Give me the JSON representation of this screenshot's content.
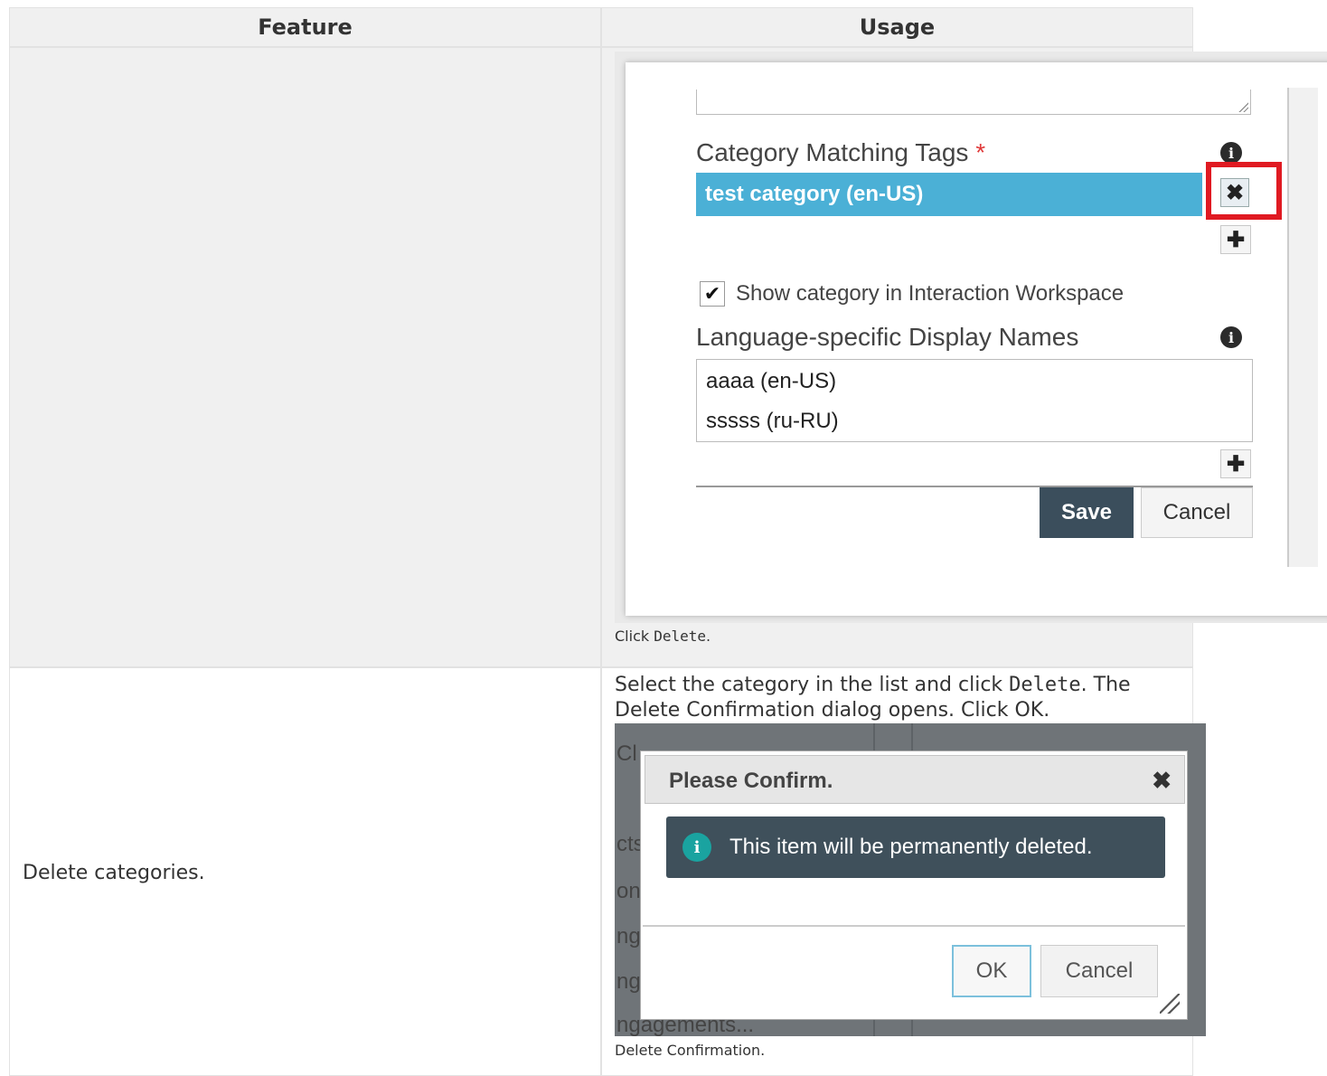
{
  "table": {
    "headers": {
      "feature": "Feature",
      "usage": "Usage"
    },
    "row1": {
      "caption_before": "Click ",
      "caption_code": "Delete",
      "caption_after": "."
    },
    "row2": {
      "feature": "Delete categories.",
      "usage_before": "Select the category in the list and click ",
      "usage_code": "Delete",
      "usage_after": ". The Delete Confirmation dialog opens. Click OK.",
      "caption": "Delete Confirmation."
    }
  },
  "screenshot1": {
    "tags_label": "Category Matching Tags",
    "required_marker": "*",
    "tag_value": "test category (en-US)",
    "delete_glyph": "✖",
    "add_glyph": "✚",
    "checkbox_checked": true,
    "checkbox_glyph": "✔",
    "checkbox_label": "Show category in Interaction Workspace",
    "names_label": "Language-specific Display Names",
    "names": [
      "aaaa (en-US)",
      "sssss (ru-RU)"
    ],
    "save_label": "Save",
    "cancel_label": "Cancel",
    "info_glyph": "i",
    "highlight_color": "#e01a22",
    "tag_color": "#4bb0d6"
  },
  "screenshot2": {
    "bg_fragments": [
      "Cl",
      "cts",
      "on",
      "ng",
      "ng",
      "ngagements..."
    ],
    "title": "Please Confirm.",
    "close_glyph": "✖",
    "info_glyph": "i",
    "message": "This item will be permanently deleted.",
    "ok_label": "OK",
    "cancel_label": "Cancel",
    "alert_color": "#3f505b"
  }
}
